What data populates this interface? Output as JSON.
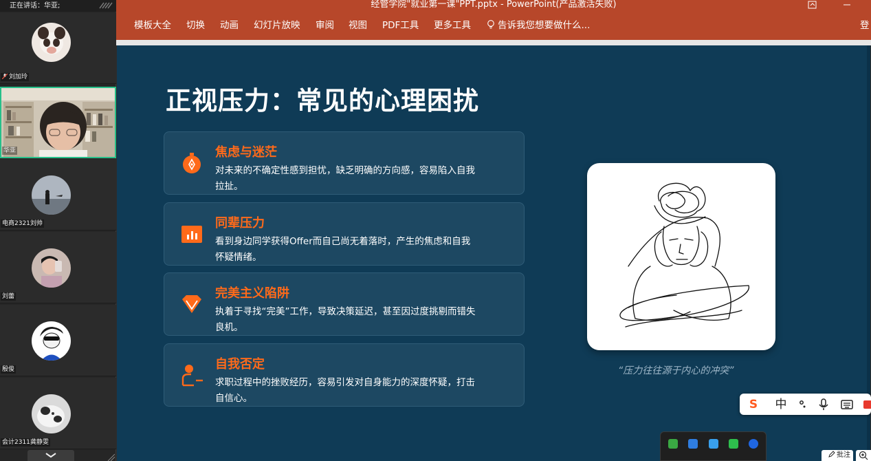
{
  "meeting": {
    "speaking_label": "正在讲话：华亚;",
    "participants": [
      {
        "name": "刘加玲",
        "muted": true
      },
      {
        "name": "华亚",
        "active": true
      },
      {
        "name": "电商2321刘帅"
      },
      {
        "name": "刘蕾"
      },
      {
        "name": "殷俊"
      },
      {
        "name": "会计2311龚静雯"
      }
    ]
  },
  "window": {
    "title": "经管学院\"就业第一课\"PPT.pptx - PowerPoint(产品激活失败)"
  },
  "ribbon": {
    "tabs": [
      "模板大全",
      "切换",
      "动画",
      "幻灯片放映",
      "审阅",
      "视图",
      "PDF工具",
      "更多工具"
    ],
    "tell_me": "告诉我您想要做什么...",
    "signin": "登"
  },
  "slide": {
    "title": "正视压力：常见的心理困扰",
    "cards": [
      {
        "title": "焦虑与迷茫",
        "desc": "对未来的不确定性感到担忧，缺乏明确的方向感，容易陷入自我拉扯。",
        "icon": "compass-icon"
      },
      {
        "title": "同辈压力",
        "desc": "看到身边同学获得Offer而自己尚无着落时，产生的焦虑和自我怀疑情绪。",
        "icon": "bar-chart-icon"
      },
      {
        "title": "完美主义陷阱",
        "desc": "执着于寻找“完美”工作，导致决策延迟，甚至因过度挑剔而错失良机。",
        "icon": "diamond-icon"
      },
      {
        "title": "自我否定",
        "desc": "求职过程中的挫败经历，容易引发对自身能力的深度怀疑，打击自信心。",
        "icon": "person-minus-icon"
      }
    ],
    "quote": "“压力往往源于内心的冲突”"
  },
  "ime": {
    "mode": "中"
  },
  "overlay": {
    "annotate": "批注"
  },
  "colors": {
    "accent": "#ff6a1a",
    "ribbon": "#b7472a",
    "slide_bg": "#0f3b56",
    "active_border": "#27c08a"
  }
}
